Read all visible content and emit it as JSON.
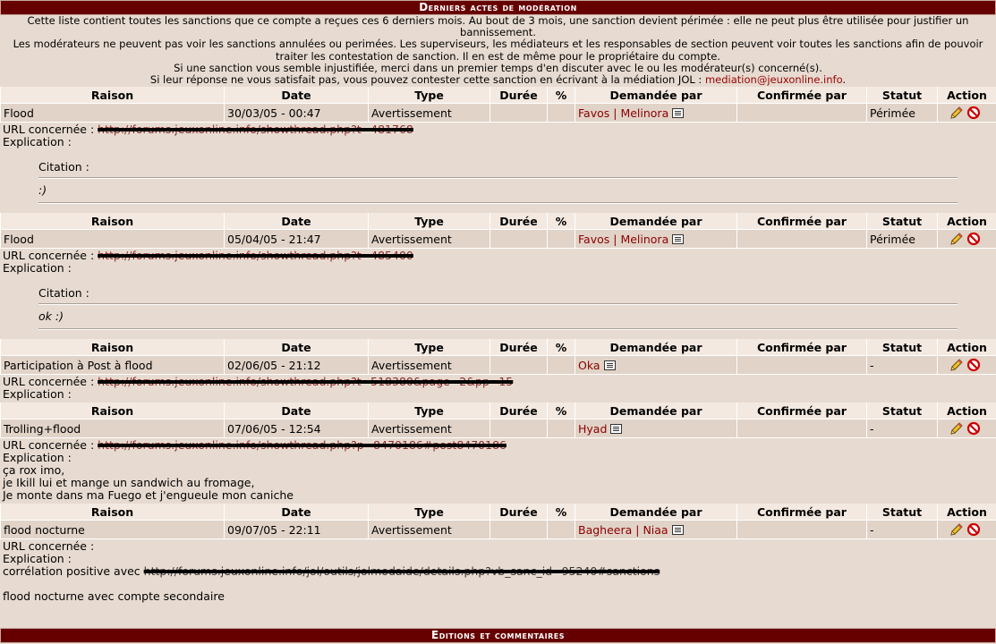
{
  "header": {
    "title": "Derniers actes de modération",
    "intro": [
      "Cette liste contient toutes les sanctions que ce compte a reçues ces 6 derniers mois. Au bout de 3 mois, une sanction devient périmée : elle ne peut plus être utilisée pour justifier un bannissement.",
      "Les modérateurs ne peuvent pas voir les sanctions annulées ou perimées. Les superviseurs, les médiateurs et les responsables de section peuvent voir toutes les sanctions afin de pouvoir traiter les contestation de sanction. Il en est de même pour le propriétaire du compte.",
      "Si une sanction vous semble injustifiée, merci dans un premier temps d'en discuter avec le ou les modérateur(s) concerné(s)."
    ],
    "intro_last": "Si leur réponse ne vous satisfait pas, vous pouvez contester cette sanction en écrivant à la médiation JOL : ",
    "mediation_link": "mediation@jeuxonline.info",
    "intro_end": "."
  },
  "columns": {
    "raison": "Raison",
    "date": "Date",
    "type": "Type",
    "duree": "Durée",
    "pct": "%",
    "demandee": "Demandée par",
    "confirmee": "Confirmée par",
    "statut": "Statut",
    "action": "Action"
  },
  "labels": {
    "url": "URL concernée : ",
    "explication": "Explication :",
    "citation": "Citation :",
    "separator": " | "
  },
  "sanctions": [
    {
      "raison": "Flood",
      "date": "30/03/05 - 00:47",
      "type": "Avertissement",
      "duree": "",
      "pct": "",
      "demandee": [
        "Favos",
        "Melinora"
      ],
      "confirmee": "",
      "statut": "Périmée",
      "url": "http://forums.jeuxonline.info/showthread.php?t=481768",
      "quote": ":)"
    },
    {
      "raison": "Flood",
      "date": "05/04/05 - 21:47",
      "type": "Avertissement",
      "duree": "",
      "pct": "",
      "demandee": [
        "Favos",
        "Melinora"
      ],
      "confirmee": "",
      "statut": "Périmée",
      "url": "http://forums.jeuxonline.info/showthread.php?t=485400",
      "quote": "ok :)"
    },
    {
      "raison": "Participation à Post à flood",
      "date": "02/06/05 - 21:12",
      "type": "Avertissement",
      "duree": "",
      "pct": "",
      "demandee": [
        "Oka"
      ],
      "confirmee": "",
      "statut": "-",
      "url": "http://forums.jeuxonline.info/showthread.php?t=518380&page=2&pp=15"
    },
    {
      "raison": "Trolling+flood",
      "date": "07/06/05 - 12:54",
      "type": "Avertissement",
      "duree": "",
      "pct": "",
      "demandee": [
        "Hyad"
      ],
      "confirmee": "",
      "statut": "-",
      "url": "http://forums.jeuxonline.info/showthread.php?p=8470186#post8470186",
      "explication_lines": [
        "ça rox imo,",
        "je Ikill lui et mange un sandwich au fromage,",
        "Je monte dans ma Fuego et j'engueule mon caniche"
      ]
    },
    {
      "raison": "flood nocturne",
      "date": "09/07/05 - 22:11",
      "type": "Avertissement",
      "duree": "",
      "pct": "",
      "demandee": [
        "Bagheera",
        "Niaa"
      ],
      "confirmee": "",
      "statut": "-",
      "url": "",
      "explication_prefix": "corrélation positive avec ",
      "explication_url": "http://forums.jeuxonline.info/jol/outils/jolmodaide/details.php?vb_sanc_id=95240#sanctions",
      "explication_after": "flood nocturne avec compte secondaire"
    }
  ],
  "footer": {
    "title": "Editions et commentaires"
  },
  "colors": {
    "header_bg": "#660000",
    "row_bg": "#e1d3c8",
    "head_bg": "#f3e9e1",
    "page_bg": "#e7dbd1",
    "link": "#8b0000"
  }
}
